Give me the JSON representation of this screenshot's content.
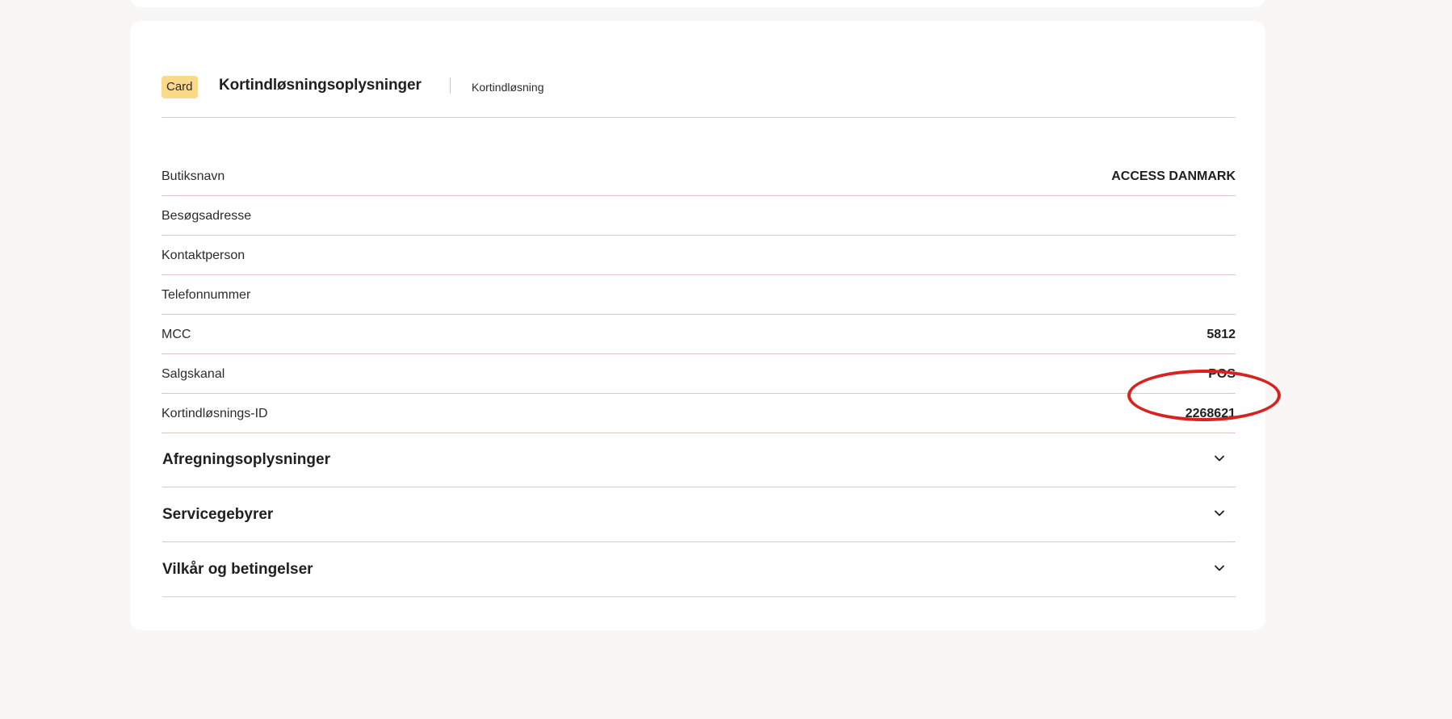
{
  "header": {
    "badge": "Card",
    "title": "Kortindløsningsoplysninger",
    "subtitle": "Kortindløsning"
  },
  "details": [
    {
      "label": "Butiksnavn",
      "value": "ACCESS DANMARK"
    },
    {
      "label": "Besøgsadresse",
      "value": ""
    },
    {
      "label": "Kontaktperson",
      "value": ""
    },
    {
      "label": "Telefonnummer",
      "value": ""
    },
    {
      "label": "MCC",
      "value": "5812"
    },
    {
      "label": "Salgskanal",
      "value": "POS"
    },
    {
      "label": "Kortindløsnings-ID",
      "value": "2268621"
    }
  ],
  "sections": [
    {
      "title": "Afregningsoplysninger",
      "icon": "chevron-down-icon"
    },
    {
      "title": "Servicegebyrer",
      "icon": "chevron-down-icon"
    },
    {
      "title": "Vilkår og betingelser",
      "icon": "chevron-down-icon"
    }
  ],
  "colors": {
    "badge_bg": "#fbd98b",
    "annotation": "#d9211f",
    "row_divider": "#e3c7be",
    "page_bg": "#f8f7f5"
  }
}
